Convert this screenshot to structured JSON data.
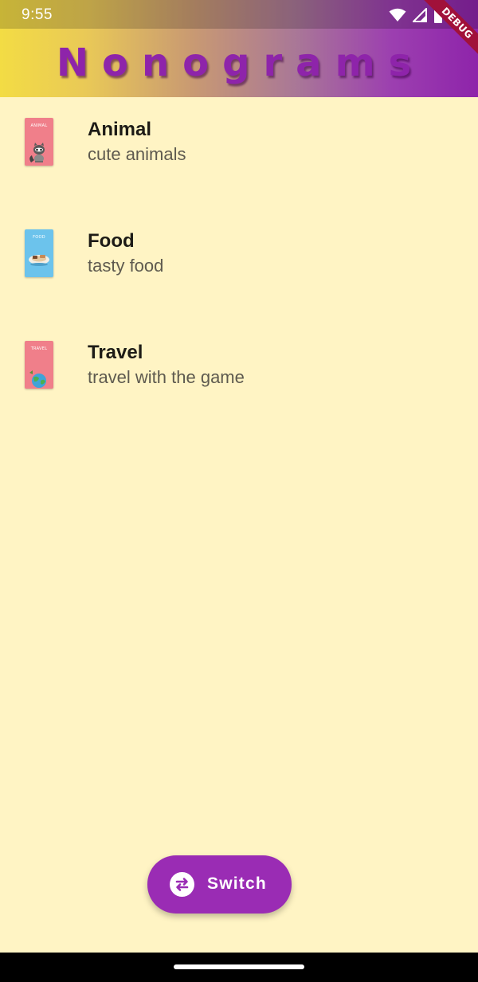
{
  "status_bar": {
    "time": "9:55",
    "icons": [
      "wifi-icon",
      "signal-icon",
      "battery-icon"
    ]
  },
  "app_bar": {
    "title": "Nonograms",
    "debug_banner": "DEBUG"
  },
  "categories": [
    {
      "title": "Animal",
      "subtitle": "cute animals",
      "thumb_label": "ANIMAL",
      "thumb_color": "#f07f8a",
      "thumb_icon": "raccoon-icon"
    },
    {
      "title": "Food",
      "subtitle": "tasty food",
      "thumb_label": "FOOD",
      "thumb_color": "#6cc3ec",
      "thumb_icon": "plate-icon"
    },
    {
      "title": "Travel",
      "subtitle": "travel with the game",
      "thumb_label": "TRAVEL",
      "thumb_color": "#f07f8a",
      "thumb_icon": "globe-icon"
    }
  ],
  "fab": {
    "label": "Switch",
    "icon": "swap-icon"
  },
  "colors": {
    "accent": "#8e24aa",
    "background": "#fff4c4",
    "gradient_start": "#f3dc44",
    "gradient_end": "#8e24aa"
  }
}
